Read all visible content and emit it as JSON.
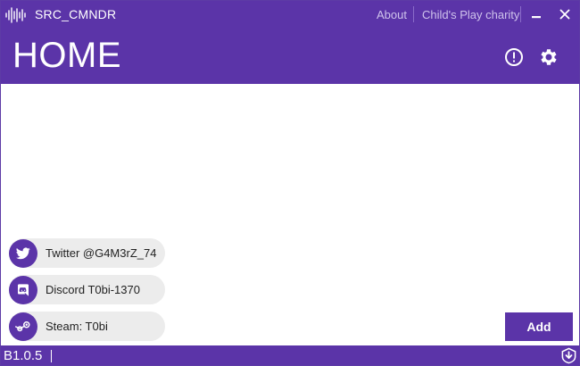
{
  "window": {
    "title": "SRC_CMNDR",
    "links": {
      "about": "About",
      "charity": "Child's Play charity"
    },
    "minimize_label": "–",
    "close_label": "✕"
  },
  "header": {
    "title": "HOME",
    "icons": [
      "alert-circle-icon",
      "gear-icon"
    ]
  },
  "contacts": [
    {
      "icon": "twitter-icon",
      "label": "Twitter @G4M3rZ_74"
    },
    {
      "icon": "discord-icon",
      "label": "Discord T0bi-1370"
    },
    {
      "icon": "steam-icon",
      "label": "Steam: T0bi"
    }
  ],
  "actions": {
    "add_label": "Add"
  },
  "status": {
    "version": "B1.0.5",
    "update_icon": "download-shield-icon"
  },
  "colors": {
    "accent": "#5b34a8",
    "pill_bg": "#ececec",
    "link": "#cfc3ec"
  }
}
